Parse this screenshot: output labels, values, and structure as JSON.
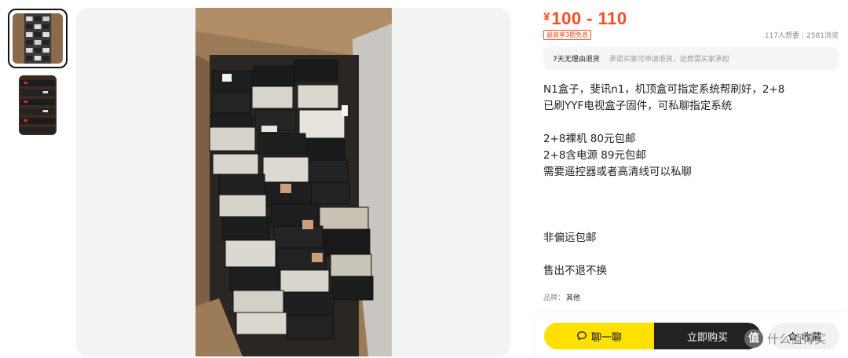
{
  "price": {
    "currency": "¥",
    "value": "100 - 110"
  },
  "badge": "最高享3期免息",
  "stats": {
    "wants": "117人想要",
    "views": "2581浏览"
  },
  "guarantee": {
    "title": "7天无理由退货",
    "description": "承诺买家可申请退货，运费需买家承担"
  },
  "description": {
    "lines": [
      "N1盒子，斐讯n1，机顶盒可指定系统帮刷好，2+8",
      "已刷YYF电视盒子固件，可私聊指定系统",
      "",
      "2+8裸机 80元包邮",
      "2+8含电源 89元包邮",
      "需要遥控器或者高清线可以私聊",
      "",
      "",
      "",
      "非偏远包邮",
      "",
      "售出不退不换"
    ]
  },
  "brand": {
    "label": "品牌：",
    "value": "其他"
  },
  "actions": {
    "chat": "聊一聊",
    "buy": "立即购买",
    "favorite": "收藏"
  },
  "watermark": {
    "logo": "值",
    "text": "什么值得买"
  },
  "icons": {
    "chat": "chat-bubble-icon",
    "favorite": "star-icon"
  },
  "colors": {
    "price": "#ff4a22",
    "chat_button": "#ffe100",
    "buy_button": "#222222"
  }
}
